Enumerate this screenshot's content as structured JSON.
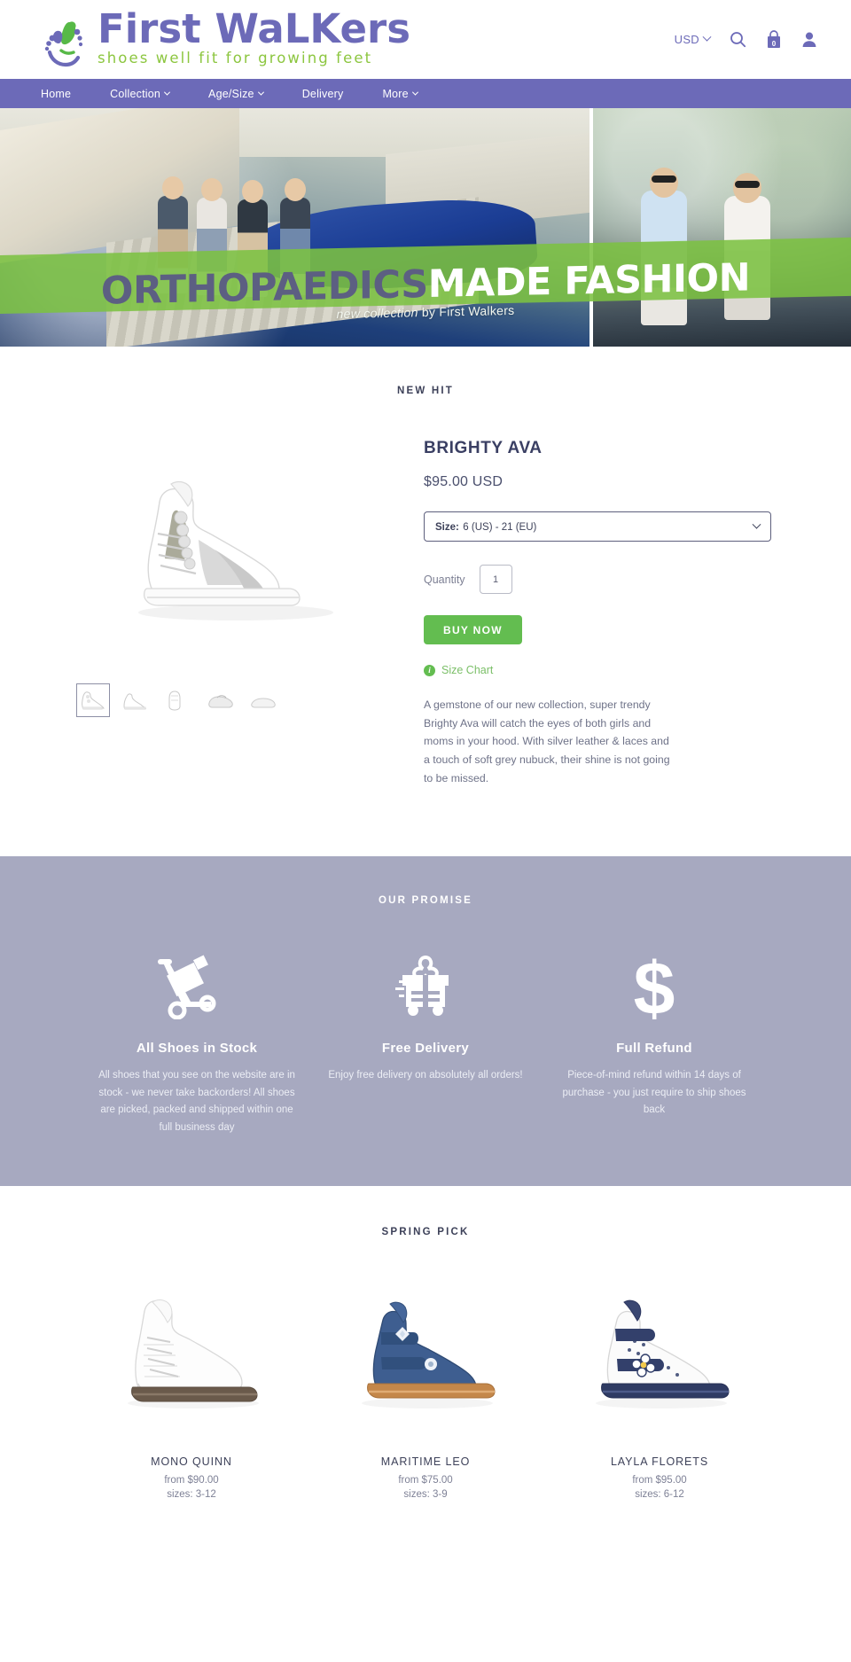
{
  "header": {
    "logo_word_1": "First",
    "logo_word_2": "WaLKers",
    "tagline": "shoes well fit for growing feet",
    "currency": "USD",
    "cart_count": "0",
    "icons": {
      "search": "search-icon",
      "cart": "cart-icon",
      "account": "user-icon"
    }
  },
  "nav": {
    "items": [
      {
        "label": "Home",
        "caret": false
      },
      {
        "label": "Collection",
        "caret": true
      },
      {
        "label": "Age/Size",
        "caret": true
      },
      {
        "label": "Delivery",
        "caret": false
      },
      {
        "label": "More",
        "caret": true
      }
    ]
  },
  "banner": {
    "title_part_1": "ORTHOPAEDICS",
    "title_part_2": "MADE FASHION",
    "subtitle_italic": "new collection",
    "subtitle_rest": " by First Walkers"
  },
  "product": {
    "eyebrow": "NEW HIT",
    "title": "BRIGHTY AVA",
    "price": "$95.00 USD",
    "size_label": "Size:",
    "size_value": "6 (US) - 21 (EU)",
    "quantity_label": "Quantity",
    "quantity_value": "1",
    "buy_label": "BUY NOW",
    "size_chart_label": "Size Chart",
    "description": "A gemstone of our new collection, super trendy Brighty Ava will catch the eyes of both girls and moms in your hood. With silver leather & laces and a touch of soft grey nubuck, their shine is not going to be missed.",
    "thumbs": [
      {
        "name": "thumb-1",
        "active": true
      },
      {
        "name": "thumb-2",
        "active": false
      },
      {
        "name": "thumb-3",
        "active": false
      },
      {
        "name": "thumb-4",
        "active": false
      },
      {
        "name": "thumb-5",
        "active": false
      }
    ]
  },
  "promise": {
    "eyebrow": "OUR PROMISE",
    "items": [
      {
        "icon": "dolly-cart-icon",
        "title": "All Shoes in Stock",
        "text": "All shoes that you see on the website are in stock - we never take backorders! All shoes are picked, packed and shipped within one full business day"
      },
      {
        "icon": "delivery-truck-gift-icon",
        "title": "Free Delivery",
        "text": "Enjoy free delivery on absolutely all orders!"
      },
      {
        "icon": "dollar-sign-icon",
        "title": "Full Refund",
        "text": "Piece-of-mind refund within 14 days of purchase - you just require to ship shoes back"
      }
    ]
  },
  "spring": {
    "eyebrow": "SPRING PICK",
    "products": [
      {
        "name": "MONO QUINN",
        "price": "from $90.00",
        "sizes": "sizes: 3-12"
      },
      {
        "name": "MARITIME LEO",
        "price": "from $75.00",
        "sizes": "sizes: 3-9"
      },
      {
        "name": "LAYLA FLORETS",
        "price": "from $95.00",
        "sizes": "sizes: 6-12"
      }
    ]
  },
  "colors": {
    "brand_purple": "#6c6ab8",
    "brand_green": "#8cc63f",
    "buy_green": "#63bd50",
    "promise_bg": "#a7a9c0",
    "band_green": "#7cc142",
    "text_dark": "#3d4159"
  }
}
